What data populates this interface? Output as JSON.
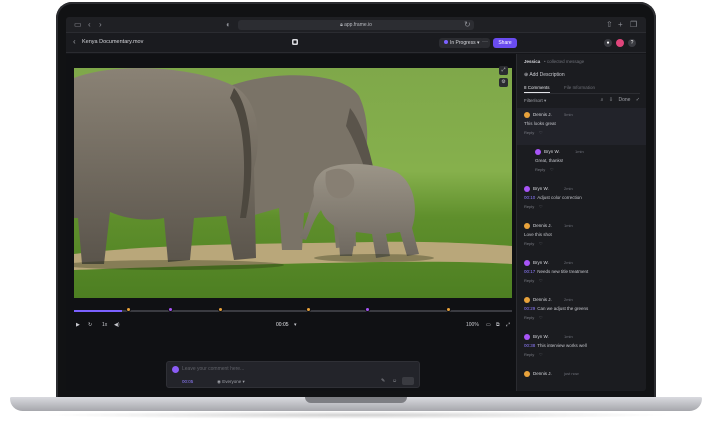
{
  "browser": {
    "url": "app.frame.io",
    "left_icons": [
      "sidebar-icon",
      "back-icon",
      "forward-icon"
    ],
    "right_icons": [
      "share-icon",
      "new-tab-icon",
      "tabs-icon"
    ]
  },
  "header": {
    "file_name": "Kenya Documentary.mov",
    "status": "In Progress",
    "more_label": "···",
    "share_label": "Share",
    "colors": {
      "accent": "#6a4cf0",
      "avatar_pink": "#e0457b"
    }
  },
  "player": {
    "current_time": "00:05",
    "playback_rate": "1x",
    "zoom": "100%",
    "progress": 0.11,
    "markers": [
      {
        "pos": 0.125,
        "color": "#e8a23b"
      },
      {
        "pos": 0.22,
        "color": "#a855f7"
      },
      {
        "pos": 0.335,
        "color": "#e8a23b"
      },
      {
        "pos": 0.535,
        "color": "#e8a23b"
      },
      {
        "pos": 0.67,
        "color": "#a855f7"
      },
      {
        "pos": 0.855,
        "color": "#e8a23b"
      }
    ]
  },
  "composer": {
    "placeholder": "Leave your comment here...",
    "timestamp": "00:05",
    "visibility": "Everyone"
  },
  "panel": {
    "user": "Jessica",
    "user_sub": "• collected message",
    "add_description": "Add Description",
    "tab_comments": "8 Comments",
    "tab_fields": "File Information",
    "filter_label": "Filter/sort",
    "done_label": "Done"
  },
  "comments": [
    {
      "name": "Dennis J.",
      "time": "5min",
      "ts": "",
      "text": "This looks great",
      "reply": "Reply",
      "color": "#e8a23b"
    },
    {
      "name": "Bryn W.",
      "time": "1min",
      "ts": "",
      "text": "Great, thanks!",
      "reply": "Reply",
      "color": "#a855f7",
      "indent": true
    },
    {
      "name": "Bryn W.",
      "time": "2min",
      "ts": "00:10",
      "text": "Adjust color correction",
      "reply": "Reply",
      "color": "#a855f7"
    },
    {
      "name": "Dennis J.",
      "time": "1min",
      "ts": "",
      "text": "Love this shot",
      "reply": "Reply",
      "color": "#e8a23b"
    },
    {
      "name": "Bryn W.",
      "time": "2min",
      "ts": "00:17",
      "text": "Needs new title treatment",
      "reply": "Reply",
      "color": "#a855f7"
    },
    {
      "name": "Dennis J.",
      "time": "2min",
      "ts": "00:29",
      "text": "Can we adjust the greens",
      "reply": "Reply",
      "color": "#e8a23b"
    },
    {
      "name": "Bryn W.",
      "time": "1min",
      "ts": "00:38",
      "text": "This interview works well",
      "reply": "Reply",
      "color": "#a855f7"
    },
    {
      "name": "Dennis J.",
      "time": "just now",
      "ts": "",
      "text": "",
      "reply": "",
      "color": "#e8a23b"
    }
  ]
}
